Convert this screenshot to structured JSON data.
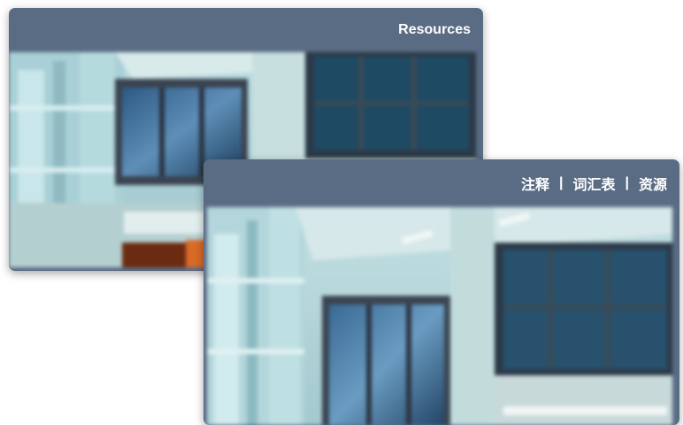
{
  "back_panel": {
    "header_link": "Resources"
  },
  "front_panel": {
    "nav": [
      {
        "label": "注释"
      },
      {
        "label": "词汇表"
      },
      {
        "label": "资源"
      }
    ],
    "separator": "|"
  },
  "photo": {
    "description_icon": "building-interior-image"
  },
  "colors": {
    "panel": "#5a6c84",
    "header_text": "#ffffff"
  }
}
